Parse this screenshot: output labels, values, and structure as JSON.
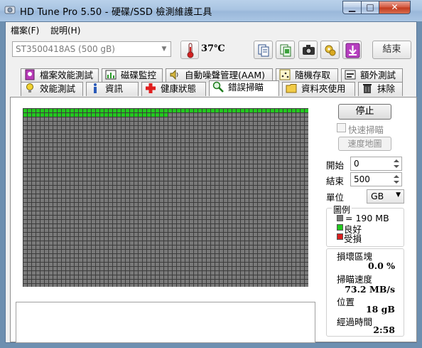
{
  "window": {
    "title": "HD Tune Pro 5.50 - 硬碟/SSD 檢測維護工具",
    "min_glyph": "▁",
    "max_glyph": "□",
    "close_glyph": "✕"
  },
  "menu": {
    "file": "檔案(F)",
    "help": "說明(H)"
  },
  "toolbar": {
    "drive": "ST3500418AS (500 gB)",
    "temperature": "37℃",
    "exit_label": "結束",
    "icons": [
      "copy-text-icon",
      "copy-screenshot-icon",
      "camera-icon",
      "options-icon",
      "save-down-icon"
    ]
  },
  "tabs": {
    "row1": [
      "檔案效能測試",
      "磁碟監控",
      "自動噪聲管理(AAM)",
      "隨機存取",
      "額外測試"
    ],
    "row2": [
      "效能測試",
      "資訊",
      "健康狀態",
      "錯誤掃瞄",
      "資料夾使用",
      "抹除"
    ],
    "active": "錯誤掃瞄"
  },
  "scan": {
    "stop_label": "停止",
    "quick_scan_label": "快速掃瞄",
    "quick_scan_checked": false,
    "speed_map_label": "速度地圖",
    "start_label": "開始",
    "start_value": "0",
    "end_label": "結束",
    "end_value": "500",
    "unit_label": "單位",
    "unit_value": "GB",
    "progress_fraction": 0.036
  },
  "legend": {
    "title": "圖例",
    "block_size": "= 190 MB",
    "good_label": "良好",
    "damaged_label": "受損"
  },
  "stats": {
    "damaged_blocks_label": "損壞區塊",
    "damaged_blocks_value": "0.0 %",
    "scan_speed_label": "掃瞄速度",
    "scan_speed_value": "73.2 MB/s",
    "position_label": "位置",
    "position_value": "18 gB",
    "elapsed_label": "經過時間",
    "elapsed_value": "2:58"
  },
  "colors": {
    "good": "#22c81e",
    "unscanned": "#7a7a7a",
    "damaged": "#d81e1e",
    "grid_line": "#3c3c3c"
  }
}
